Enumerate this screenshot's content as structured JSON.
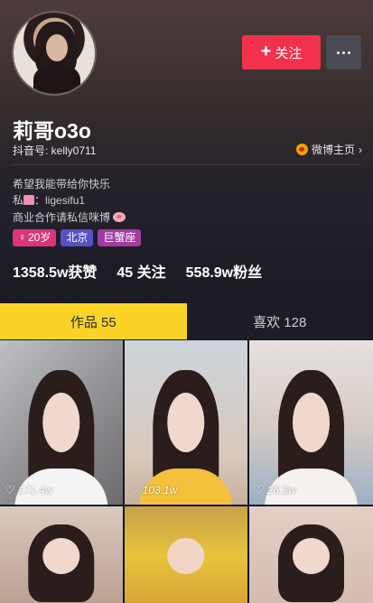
{
  "profile": {
    "nickname": "莉哥o3o",
    "douyin_id": "抖音号: kelly0711",
    "weibo_link": "微博主页",
    "bio_line1": "希望我能带给你快乐",
    "bio_line2_prefix": "私",
    "bio_line2_text": "：ligesifu1",
    "bio_line3": "商业合作请私信咪博",
    "tags": [
      "20岁",
      "北京",
      "巨蟹座"
    ],
    "tag_age_icon": "♀",
    "stats": {
      "likes": "1358.5w获赞",
      "following": "45 关注",
      "followers": "558.9w粉丝"
    }
  },
  "actions": {
    "follow_label": "关注",
    "follow_icon": "+",
    "more_icon": "more-dots-icon"
  },
  "tabs": {
    "works": "作品 55",
    "likes": "喜欢 128"
  },
  "videos": [
    {
      "likes": "171.4w"
    },
    {
      "likes": "103.1w"
    },
    {
      "likes": "26.3w"
    },
    {
      "likes": ""
    },
    {
      "likes": ""
    },
    {
      "likes": ""
    }
  ],
  "colors": {
    "follow_button": "#f2324d",
    "active_tab": "#fbd326",
    "tag_age": "#d9367a",
    "tag_city": "#5a4fc4",
    "tag_zodiac": "#a23ca0"
  }
}
